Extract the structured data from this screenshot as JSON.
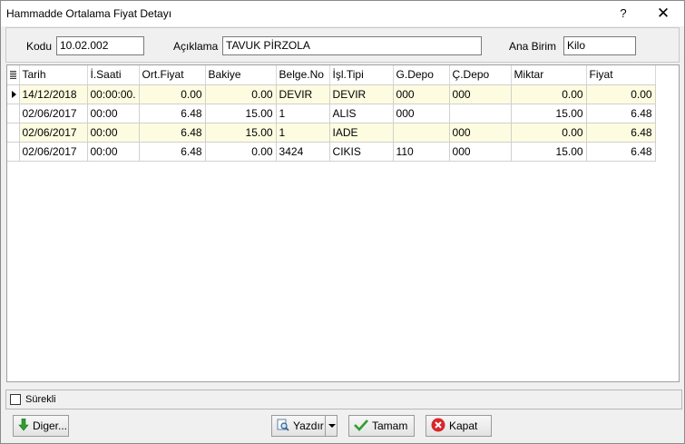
{
  "window": {
    "title": "Hammadde Ortalama Fiyat Detayı",
    "help_glyph": "?",
    "close_glyph": "✕"
  },
  "header": {
    "kodu_label": "Kodu",
    "kodu_value": "10.02.002",
    "aciklama_label": "Açıklama",
    "aciklama_value": "TAVUK PİRZOLA",
    "ana_birim_label": "Ana Birim",
    "ana_birim_value": "Kilo"
  },
  "grid": {
    "columns": [
      "Tarih",
      "İ.Saati",
      "Ort.Fiyat",
      "Bakiye",
      "Belge.No",
      "İşl.Tipi",
      "G.Depo",
      "Ç.Depo",
      "Miktar",
      "Fiyat"
    ],
    "rows": [
      [
        "14/12/2018",
        "00:00:00.",
        "0.00",
        "0.00",
        "DEVIR",
        "DEVIR",
        "000",
        "000",
        "0.00",
        "0.00"
      ],
      [
        "02/06/2017",
        "00:00",
        "6.48",
        "15.00",
        "1",
        "ALIS",
        "000",
        "",
        "15.00",
        "6.48"
      ],
      [
        "02/06/2017",
        "00:00",
        "6.48",
        "15.00",
        "1",
        "IADE",
        "",
        "000",
        "0.00",
        "6.48"
      ],
      [
        "02/06/2017",
        "00:00",
        "6.48",
        "0.00",
        "3424",
        "CIKIS",
        "110",
        "000",
        "15.00",
        "6.48"
      ]
    ],
    "selected_row": 0
  },
  "footer": {
    "surekli_label": "Sürekli",
    "surekli_checked": false,
    "diger_label": "Diger...",
    "yazdir_label": "Yazdır",
    "tamam_label": "Tamam",
    "kapat_label": "Kapat"
  },
  "colors": {
    "row_highlight": "#fdfce0",
    "window_bg": "#f0f0f0"
  }
}
